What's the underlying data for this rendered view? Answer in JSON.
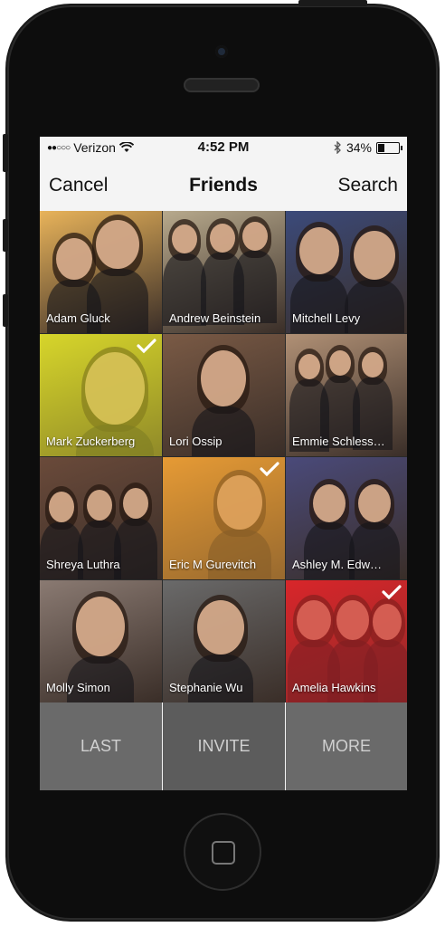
{
  "status": {
    "carrier": "Verizon",
    "signal_dots": "●●○○○",
    "time": "4:52 PM",
    "battery_text": "34%",
    "battery_level": 0.34
  },
  "nav": {
    "cancel_label": "Cancel",
    "title": "Friends",
    "search_label": "Search"
  },
  "friends": [
    {
      "name": "Adam Gluck",
      "selected": false,
      "tint": "#e8b35a"
    },
    {
      "name": "Andrew Beinstein",
      "selected": false,
      "tint": "#b7a98c"
    },
    {
      "name": "Mitchell Levy",
      "selected": false,
      "tint": "#3b4a7a"
    },
    {
      "name": "Mark Zuckerberg",
      "selected": true,
      "tint": "#d7d62a"
    },
    {
      "name": "Lori Ossip",
      "selected": false,
      "tint": "#7a5a45"
    },
    {
      "name": "Emmie Schless…",
      "selected": false,
      "tint": "#b09075"
    },
    {
      "name": "Shreya Luthra",
      "selected": false,
      "tint": "#6a4a3a"
    },
    {
      "name": "Eric M Gurevitch",
      "selected": true,
      "tint": "#e69a35"
    },
    {
      "name": "Ashley M. Edw…",
      "selected": false,
      "tint": "#4a4a7a"
    },
    {
      "name": "Molly Simon",
      "selected": false,
      "tint": "#8a7a72"
    },
    {
      "name": "Stephanie Wu",
      "selected": false,
      "tint": "#6a6a6a"
    },
    {
      "name": "Amelia Hawkins",
      "selected": true,
      "tint": "#d8262a"
    }
  ],
  "bottom": {
    "last_label": "LAST",
    "invite_label": "INVITE",
    "more_label": "MORE"
  }
}
